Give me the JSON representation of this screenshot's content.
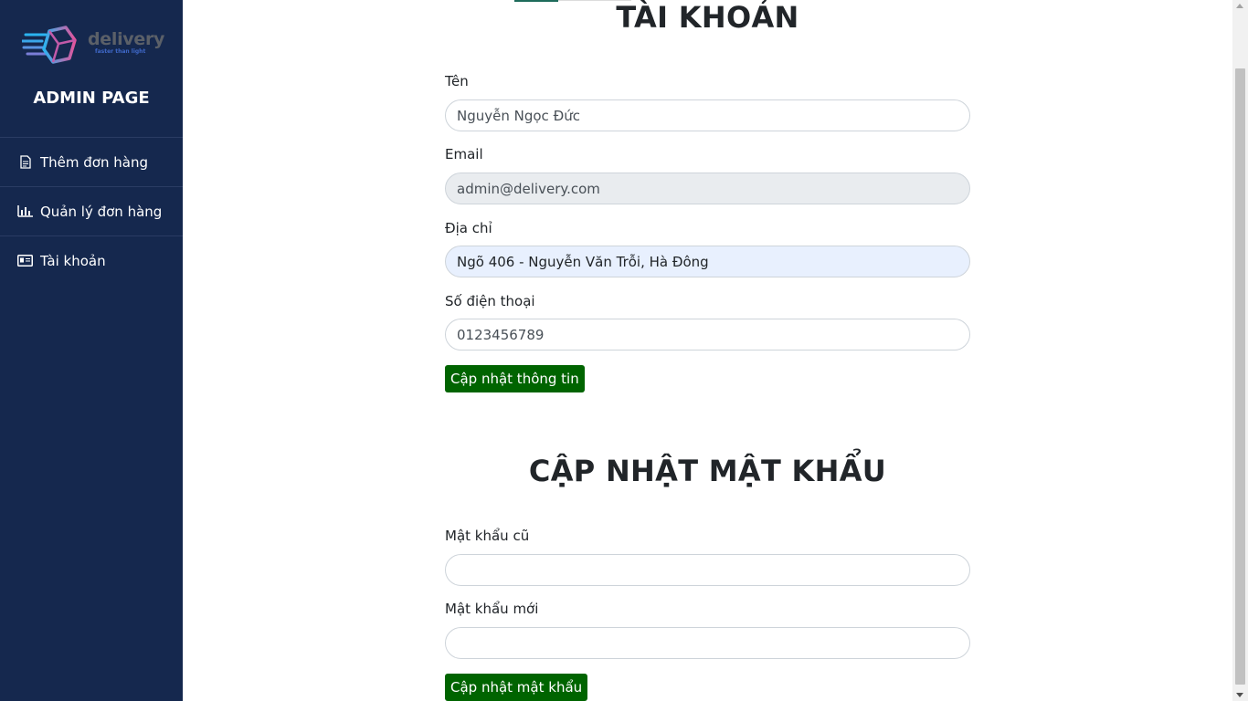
{
  "brand": {
    "logo_word": "delivery",
    "logo_tagline": "faster than light",
    "admin_title": "ADMIN PAGE",
    "accent_color": "#15284e"
  },
  "sidebar": {
    "items": [
      {
        "label": "Thêm đơn hàng",
        "icon": "document-icon"
      },
      {
        "label": "Quản lý đơn hàng",
        "icon": "bar-chart-icon"
      },
      {
        "label": "Tài khoản",
        "icon": "id-card-icon"
      }
    ]
  },
  "account": {
    "title": "TÀI KHOẢN",
    "name_label": "Tên",
    "name_value": "Nguyễn Ngọc Đức",
    "email_label": "Email",
    "email_value": "admin@delivery.com",
    "address_label": "Địa chỉ",
    "address_value": "Ngõ 406 - Nguyễn Văn Trỗi, Hà Đông",
    "phone_label": "Số điện thoại",
    "phone_value": "0123456789",
    "update_button": "Cập nhật thông tin"
  },
  "password": {
    "title": "CẬP NHẬT MẬT KHẨU",
    "old_label": "Mật khẩu cũ",
    "old_value": "",
    "new_label": "Mật khẩu mới",
    "new_value": "",
    "update_button": "Cập nhật mật khẩu"
  },
  "colors": {
    "button": "#006400",
    "sidebar": "#15284e"
  }
}
